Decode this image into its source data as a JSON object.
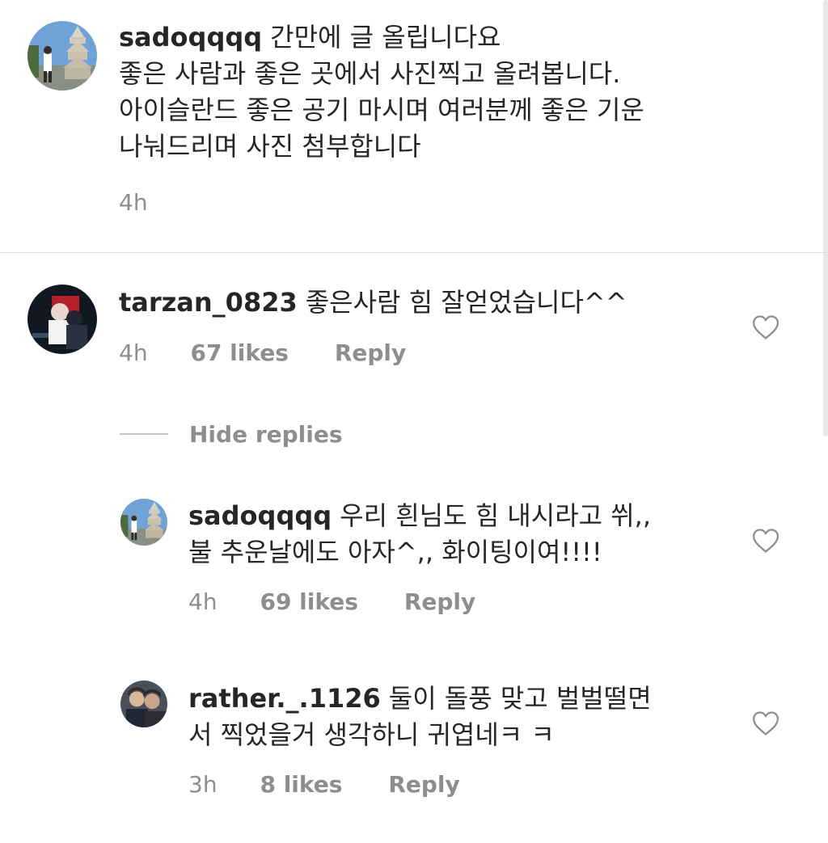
{
  "caption": {
    "username": "sadoqqqq",
    "lines": [
      "간만에 글 올립니다요",
      "좋은 사람과 좋은 곳에서 사진찍고 올려봅니다.",
      "아이슬란드 좋은 공기 마시며 여러분께 좋은 기운",
      "나눠드리며 사진 첨부합니다"
    ],
    "time": "4h"
  },
  "comments": [
    {
      "username": "tarzan_0823",
      "lines": [
        "좋은사람 힘 잘얻었습니다^^"
      ],
      "time": "4h",
      "likes": "67 likes",
      "reply_label": "Reply"
    }
  ],
  "hide_replies_label": "Hide replies",
  "replies": [
    {
      "username": "sadoqqqq",
      "lines": [
        "우리 흰님도 힘 내시라고 쒸,,",
        "불 추운날에도 아자^,, 화이팅이여!!!!"
      ],
      "time": "4h",
      "likes": "69 likes",
      "reply_label": "Reply"
    },
    {
      "username": "rather._.1126",
      "lines": [
        "둘이 돌풍 맞고 벌벌떨면",
        "서 찍었을거 생각하니 귀엽네ㅋ ㅋ"
      ],
      "time": "3h",
      "likes": "8 likes",
      "reply_label": "Reply"
    }
  ]
}
